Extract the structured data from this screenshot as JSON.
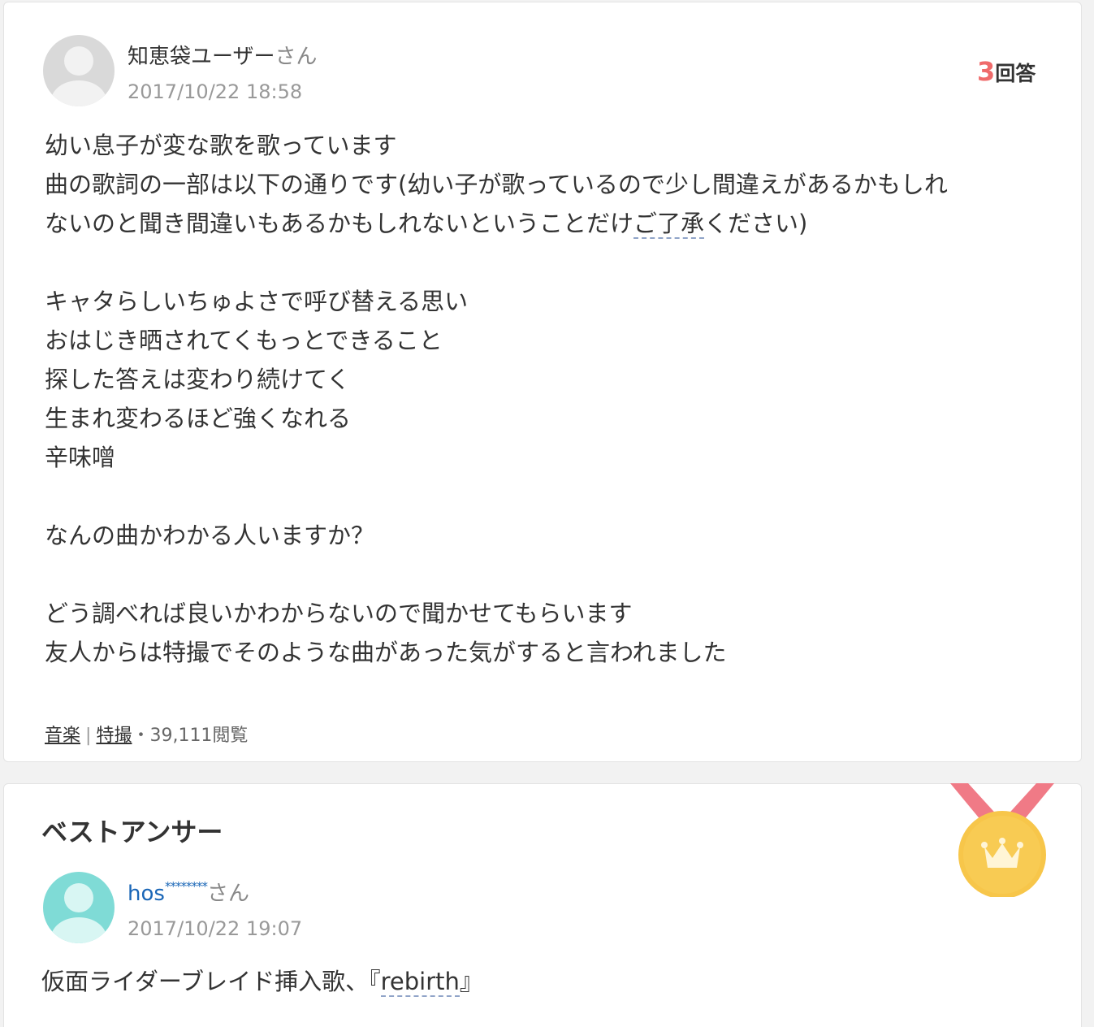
{
  "question": {
    "user": {
      "name": "知恵袋ユーザー",
      "suffix": "さん"
    },
    "date": "2017/10/22 18:58",
    "answer_count": {
      "number": "3",
      "label": "回答"
    },
    "body": {
      "line1": "幼い息子が変な歌を歌っています",
      "line2": "曲の歌詞の一部は以下の通りです(幼い子が歌っているので少し間違えがあるかもしれ",
      "line3_pre": "ないのと聞き間違いもあるかもしれないということだけ",
      "line3_link": "ご了承",
      "line3_post": "ください)",
      "lyric1": "キャタらしいちゅよさで呼び替える思い",
      "lyric2": "おはじき晒されてくもっとできること",
      "lyric3": "探した答えは変わり続けてく",
      "lyric4": "生まれ変わるほど強くなれる",
      "lyric5": "辛味噌",
      "question_line": "なんの曲かわかる人いますか？",
      "closing1": "どう調べれば良いかわからないので聞かせてもらいます",
      "closing2": "友人からは特撮でそのような曲があった気がすると言われました"
    },
    "meta": {
      "category1": "音楽",
      "separator": "|",
      "category2": "特撮",
      "views": "・39,111閲覧"
    }
  },
  "best_answer": {
    "title": "ベストアンサー",
    "user": {
      "name": "hos",
      "masked": "********",
      "suffix": "さん"
    },
    "date": "2017/10/22 19:07",
    "body_pre": "仮面ライダーブレイド挿入歌、『",
    "body_link": "rebirth",
    "body_post": "』"
  },
  "colors": {
    "accent_red": "#ef6a6a",
    "link_blue": "#1a66b7",
    "medal_gold": "#f7c64a",
    "ribbon": "#f07a86"
  },
  "icons": {
    "question_avatar": "default-user-icon",
    "answer_avatar": "default-user-icon",
    "medal": "best-answer-medal-icon"
  }
}
